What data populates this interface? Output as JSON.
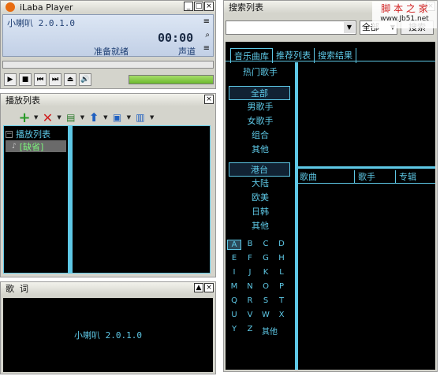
{
  "player": {
    "title": "iLaba Player",
    "version_label": "小喇叭 2.0.1.0",
    "time": "00:00",
    "status": "准备就绪",
    "channel_label": "声道",
    "progress_fraction": 0,
    "volume_fraction": 1.0
  },
  "playlist": {
    "title": "播放列表",
    "tree_root": "播放列表",
    "tree_item": "[缺省]"
  },
  "lyrics": {
    "title": "歌  词",
    "text": "小喇叭 2.0.1.0"
  },
  "search": {
    "title": "搜索列表",
    "query": "",
    "scope_select": "全部",
    "button_label": "搜索",
    "tabs": [
      "音乐曲库",
      "推荐列表",
      "搜索结果"
    ],
    "hot_singers": "热门歌手",
    "group1": {
      "header": "全部",
      "items": [
        "男歌手",
        "女歌手",
        "组合",
        "其他"
      ]
    },
    "group2": {
      "header": "港台",
      "items": [
        "大陆",
        "欧美",
        "日韩",
        "其他"
      ]
    },
    "letters": [
      "A",
      "B",
      "C",
      "D",
      "E",
      "F",
      "G",
      "H",
      "I",
      "J",
      "K",
      "L",
      "M",
      "N",
      "O",
      "P",
      "Q",
      "R",
      "S",
      "T",
      "U",
      "V",
      "W",
      "X",
      "Y",
      "Z",
      "其他"
    ],
    "columns": [
      "歌曲",
      "歌手",
      "专辑"
    ]
  },
  "watermark": {
    "line1": "脚 本 之 家",
    "line2": "www.Jb51.net"
  }
}
